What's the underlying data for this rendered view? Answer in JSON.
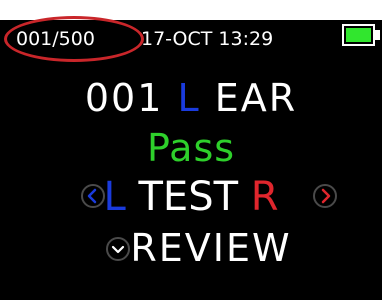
{
  "status_bar": {
    "counter": "001/500",
    "datetime": "17-OCT 13:29",
    "battery_icon": "battery-full-icon"
  },
  "main": {
    "line1": {
      "number": "001",
      "ear_side": "L",
      "label": "EAR"
    },
    "result": "Pass",
    "test": {
      "left": "L",
      "label": "TEST",
      "right": "R"
    },
    "review": "REVIEW"
  },
  "colors": {
    "background": "#000000",
    "text": "#ffffff",
    "pass": "#2ed02b",
    "left_ear": "#1a3bdd",
    "right_ear": "#e0262d",
    "battery": "#31e62e",
    "highlight": "#c9262a"
  }
}
